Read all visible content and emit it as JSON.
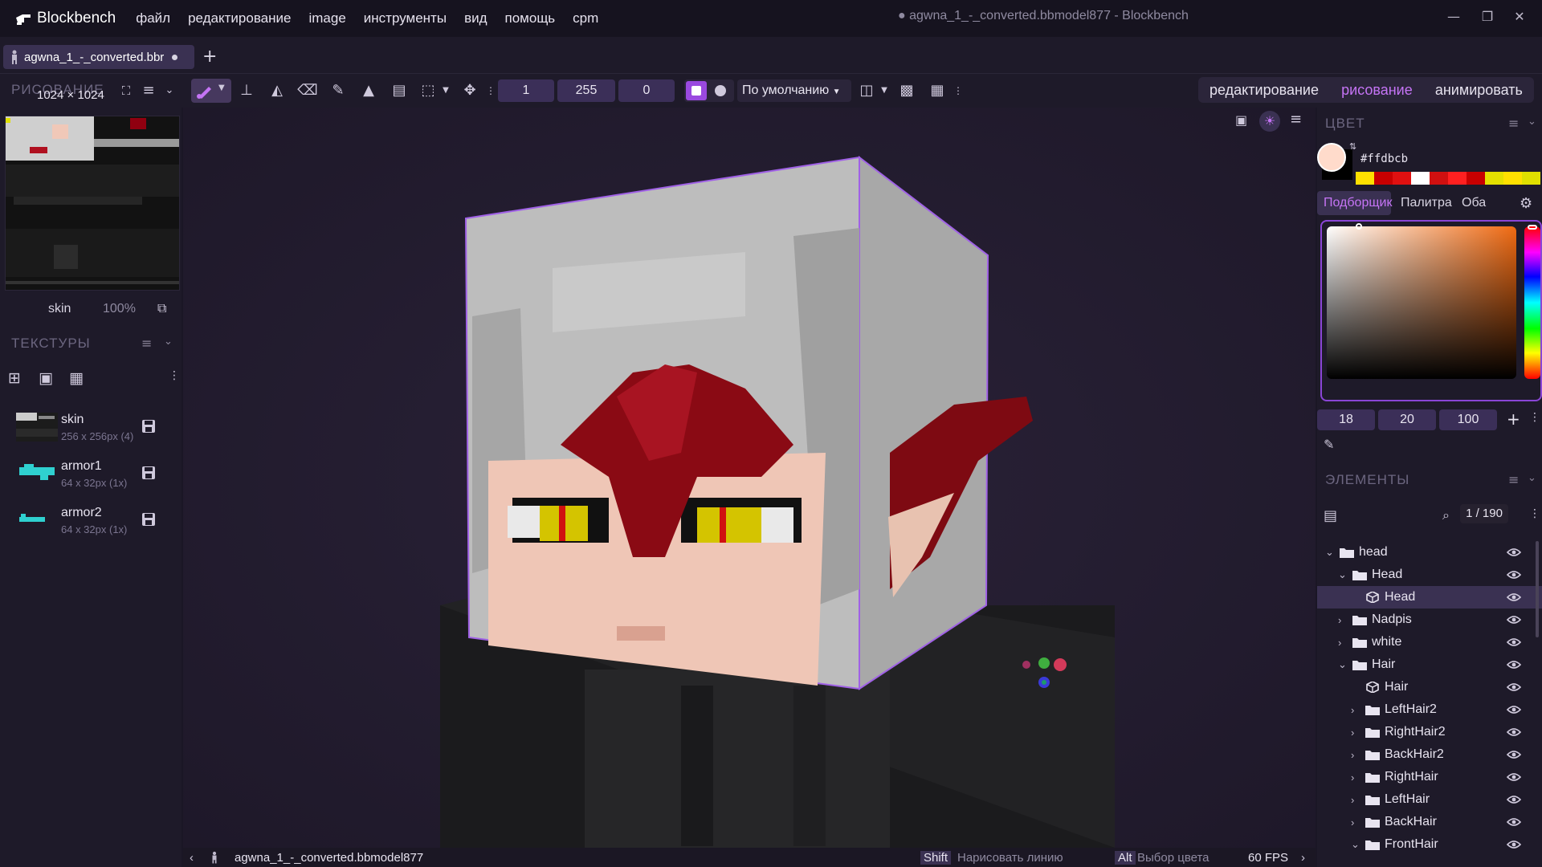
{
  "app": {
    "name": "Blockbench",
    "window_title": "● agwna_1_-_converted.bbmodel877 - Blockbench"
  },
  "menu": [
    "файл",
    "редактирование",
    "image",
    "инструменты",
    "вид",
    "помощь",
    "cpm"
  ],
  "tab": {
    "label": "agwna_1_-_converted.bbr"
  },
  "toolbar": {
    "section_label": "РИСОВАНИЕ",
    "texture_size": "1024 × 1024",
    "brush_size": "1",
    "opacity": "255",
    "softness": "0",
    "blend_mode": "По умолчанию",
    "modes": [
      "редактирование",
      "рисование",
      "анимировать"
    ],
    "active_mode": "рисование"
  },
  "left": {
    "uv_name": "skin",
    "uv_zoom": "100%",
    "textures_header": "ТЕКСТУРЫ",
    "textures": [
      {
        "name": "skin",
        "size": "256 x 256px (4)"
      },
      {
        "name": "armor1",
        "size": "64 x 32px (1x)"
      },
      {
        "name": "armor2",
        "size": "64 x 32px (1x)"
      }
    ]
  },
  "color": {
    "header": "ЦВЕТ",
    "hex": "#ffdbcb",
    "current": "#ffdbcb",
    "tabs": [
      "Подборщик",
      "Палитра",
      "Оба"
    ],
    "active_tab": "Подборщик",
    "values": [
      "18",
      "20",
      "100"
    ],
    "palette": [
      "#ffe000",
      "#c80000",
      "#e01010",
      "#ffffff",
      "#d01010",
      "#ff2020",
      "#c80000",
      "#e4e000",
      "#ffe000",
      "#e0e000"
    ]
  },
  "elements": {
    "header": "ЭЛЕМЕНТЫ",
    "count": "1 / 190",
    "tree": [
      {
        "label": "head",
        "type": "folder",
        "depth": 0,
        "expanded": true
      },
      {
        "label": "Head",
        "type": "folder",
        "depth": 1,
        "expanded": true
      },
      {
        "label": "Head",
        "type": "cube",
        "depth": 2,
        "selected": true
      },
      {
        "label": "Nadpis",
        "type": "folder",
        "depth": 1,
        "expanded": false
      },
      {
        "label": "white",
        "type": "folder",
        "depth": 1,
        "expanded": false
      },
      {
        "label": "Hair",
        "type": "folder",
        "depth": 1,
        "expanded": true
      },
      {
        "label": "Hair",
        "type": "cube",
        "depth": 2
      },
      {
        "label": "LeftHair2",
        "type": "folder",
        "depth": 2,
        "expanded": false
      },
      {
        "label": "RightHair2",
        "type": "folder",
        "depth": 2,
        "expanded": false
      },
      {
        "label": "BackHair2",
        "type": "folder",
        "depth": 2,
        "expanded": false
      },
      {
        "label": "RightHair",
        "type": "folder",
        "depth": 2,
        "expanded": false
      },
      {
        "label": "LeftHair",
        "type": "folder",
        "depth": 2,
        "expanded": false
      },
      {
        "label": "BackHair",
        "type": "folder",
        "depth": 2,
        "expanded": false
      },
      {
        "label": "FrontHair",
        "type": "folder",
        "depth": 2,
        "expanded": true
      }
    ]
  },
  "status": {
    "file": "agwna_1_-_converted.bbmodel877",
    "hint1_key": "Shift",
    "hint1": "Нарисовать линию",
    "hint2_key": "Alt",
    "hint2": "Выбор цвета",
    "fps": "60 FPS"
  }
}
